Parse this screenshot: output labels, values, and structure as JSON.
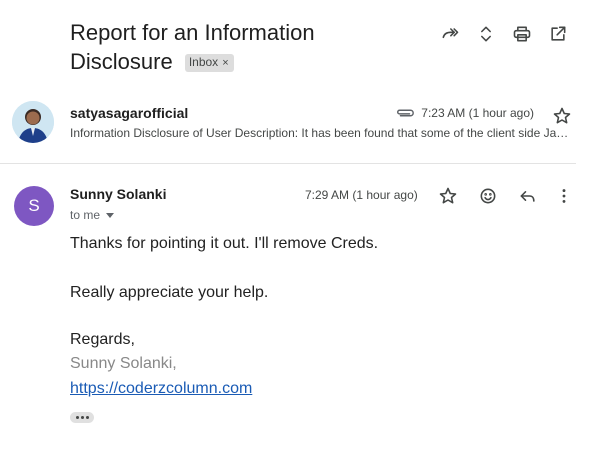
{
  "subject": {
    "line1": "Report for an Information",
    "line2": "Disclosure",
    "label_chip": "Inbox",
    "label_chip_remove": "×"
  },
  "toolbar_icons": [
    "forward-all-icon",
    "expand-collapse-icon",
    "print-icon",
    "open-in-new-window-icon"
  ],
  "message1": {
    "sender": "satyasagarofficial",
    "time": "7:23 AM (1 hour ago)",
    "snippet": "Information Disclosure of User Description: It has been found that some of the client side JavaScript files are exposing credentials"
  },
  "message2": {
    "avatar_letter": "S",
    "avatar_color": "#7e57c2",
    "sender": "Sunny Solanki",
    "recipient": "to me",
    "time": "7:29 AM (1 hour ago)",
    "body_line1": "Thanks for pointing it out. I'll remove Creds.",
    "body_line2": "Really appreciate your help.",
    "sign_off": "Regards,",
    "signature_name": "Sunny Solanki,",
    "signature_link": "https://coderzcolumn.com"
  },
  "colors": {
    "link": "#1a5bb5",
    "chip_bg": "#dddddd"
  }
}
